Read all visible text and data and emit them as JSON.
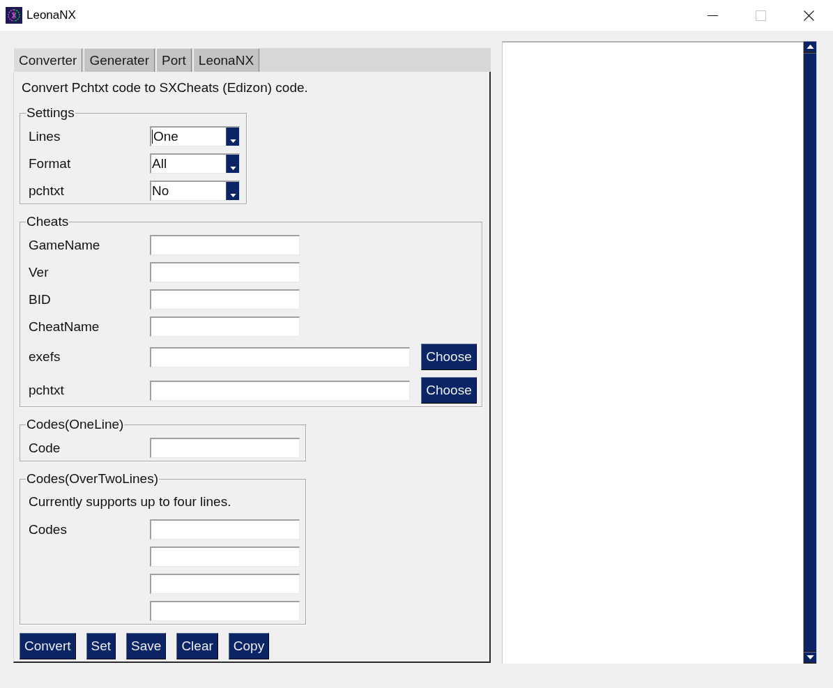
{
  "window": {
    "title": "LeonaNX",
    "controls": [
      {
        "kind": "minimize",
        "disabled": false
      },
      {
        "kind": "maximize",
        "disabled": true
      },
      {
        "kind": "close",
        "disabled": false
      }
    ]
  },
  "tabs": [
    {
      "label": "Converter",
      "selected": true
    },
    {
      "label": "Generater",
      "selected": false
    },
    {
      "label": "Port",
      "selected": false
    },
    {
      "label": "LeonaNX",
      "selected": false
    }
  ],
  "converter": {
    "description": "Convert Pchtxt code to SXCheats (Edizon) code.",
    "groups": [
      {
        "title": "Settings",
        "kind": "settings",
        "rows": [
          {
            "label": "Lines",
            "kind": "dropdown",
            "value": "One",
            "focused": true
          },
          {
            "label": "Format",
            "kind": "dropdown",
            "value": "All",
            "focused": false
          },
          {
            "label": "pchtxt",
            "kind": "dropdown",
            "value": "No",
            "focused": false
          }
        ]
      },
      {
        "title": "Cheats",
        "kind": "wide",
        "rows": [
          {
            "label": "GameName",
            "kind": "text"
          },
          {
            "label": "Ver",
            "kind": "text"
          },
          {
            "label": "BID",
            "kind": "text"
          },
          {
            "label": "CheatName",
            "kind": "text"
          },
          {
            "label": "exefs",
            "kind": "file",
            "button": "Choose"
          },
          {
            "label": "pchtxt",
            "kind": "file",
            "button": "Choose"
          }
        ]
      },
      {
        "title": "Codes(OneLine)",
        "kind": "medium",
        "rows": [
          {
            "label": "Code",
            "kind": "text"
          }
        ]
      },
      {
        "title": "Codes(OverTwoLines)",
        "kind": "medium",
        "note": "Currently supports up to four lines.",
        "rows": [
          {
            "label": "Codes",
            "kind": "text"
          },
          {
            "kind": "text"
          },
          {
            "kind": "text"
          },
          {
            "kind": "text"
          }
        ]
      }
    ],
    "buttons": [
      "Convert",
      "Set",
      "Save",
      "Clear",
      "Copy"
    ]
  }
}
